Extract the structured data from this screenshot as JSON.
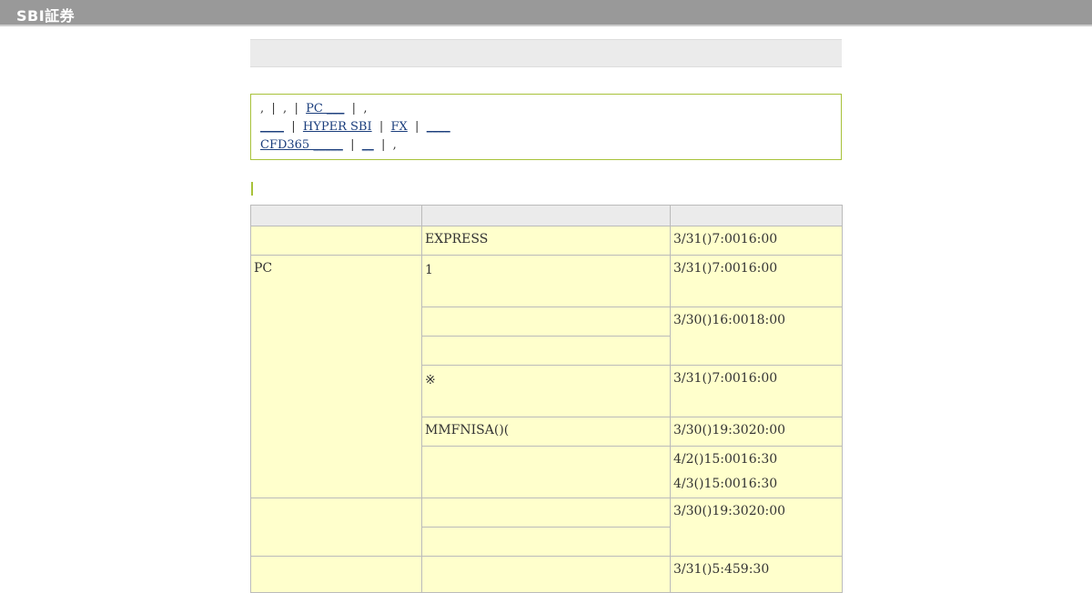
{
  "header": {
    "logo_text": "SBI証券"
  },
  "notice": {
    "line1": {
      "pre": ",  |  ,  |  ",
      "link_pc": "PC ___",
      "post": "  |  ,"
    },
    "line2": {
      "link_a": "____",
      "sep1": "  |  ",
      "link_hyper": "HYPER SBI",
      "sep2": "  |  ",
      "link_fx": "FX",
      "sep3": "  |  ",
      "link_b": "____"
    },
    "line3": {
      "link_cfd": "CFD365 _____",
      "sep1": "  |  ",
      "link_c": "__",
      "sep2": "  |  ,"
    }
  },
  "table": {
    "headers": [
      "",
      "",
      ""
    ],
    "rows": {
      "r1": {
        "cat": "",
        "item": "EXPRESS",
        "time": "3/31()7:0016:00"
      },
      "r2": {
        "cat": "PC",
        "item_line1": "",
        "item_line2": "1",
        "time": "3/31()7:0016:00"
      },
      "r3": {
        "item": "",
        "time": "3/30()16:0018:00"
      },
      "r4": {
        "item": ""
      },
      "r5": {
        "item_line1": "",
        "item_line2": "※",
        "time": "3/31()7:0016:00"
      },
      "r6": {
        "item": "MMFNISA()(",
        "time": "3/30()19:3020:00"
      },
      "r7": {
        "item": "",
        "time_line1": "4/2()15:0016:30",
        "time_line2": "4/3()15:0016:30"
      },
      "r8": {
        "cat": "",
        "item": "",
        "time": "3/30()19:3020:00"
      },
      "r9": {
        "item": ""
      },
      "r10": {
        "cat": "",
        "item": "",
        "time": "3/31()5:459:30"
      }
    }
  },
  "colors": {
    "header_bar": "#999999",
    "accent_green": "#a8c23a",
    "cell_yellow": "#ffffcc",
    "header_gray": "#ebebeb",
    "link_blue": "#1a3d7c"
  }
}
